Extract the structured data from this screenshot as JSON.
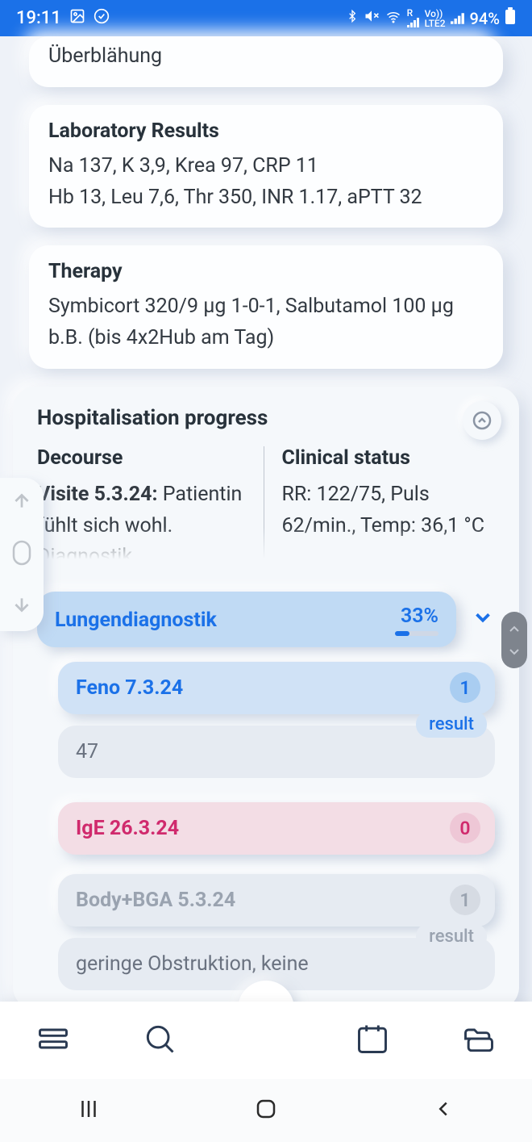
{
  "status": {
    "time": "19:11",
    "battery": "94%",
    "net": "LTE2",
    "roaming": "R",
    "volte": "Vo))"
  },
  "cards": {
    "auscultation": {
      "body_partial": "Überblähung"
    },
    "lab": {
      "title": "Laboratory Results",
      "line1": "Na 137, K 3,9, Krea 97, CRP 11",
      "line2": "Hb 13, Leu 7,6, Thr 350, INR 1.17, aPTT 32"
    },
    "therapy": {
      "title": "Therapy",
      "body": "Symbicort 320/9 µg 1-0-1, Salbutamol 100 µg b.B. (bis 4x2Hub am Tag)"
    }
  },
  "progress": {
    "title": "Hospitalisation progress",
    "decourse": {
      "title": "Decourse",
      "visit_label": "Visite 5.3.24:",
      "body": "Patientin fühlt sich wohl. Diagnostik"
    },
    "clinical": {
      "title": "Clinical status",
      "body": "RR: 122/75, Puls 62/min., Temp: 36,1 °C"
    }
  },
  "diagnostics": {
    "title": "Lungendiagnostik",
    "percent": "33%",
    "percent_value": 33,
    "items": [
      {
        "title": "Feno 7.3.24",
        "count": "1",
        "result_label": "result",
        "result_value": "47",
        "variant": "blue"
      },
      {
        "title": "IgE 26.3.24",
        "count": "0",
        "variant": "red"
      },
      {
        "title": "Body+BGA 5.3.24",
        "count": "1",
        "result_label": "result",
        "result_value": "geringe Obstruktion, keine",
        "variant": "grey"
      }
    ]
  }
}
